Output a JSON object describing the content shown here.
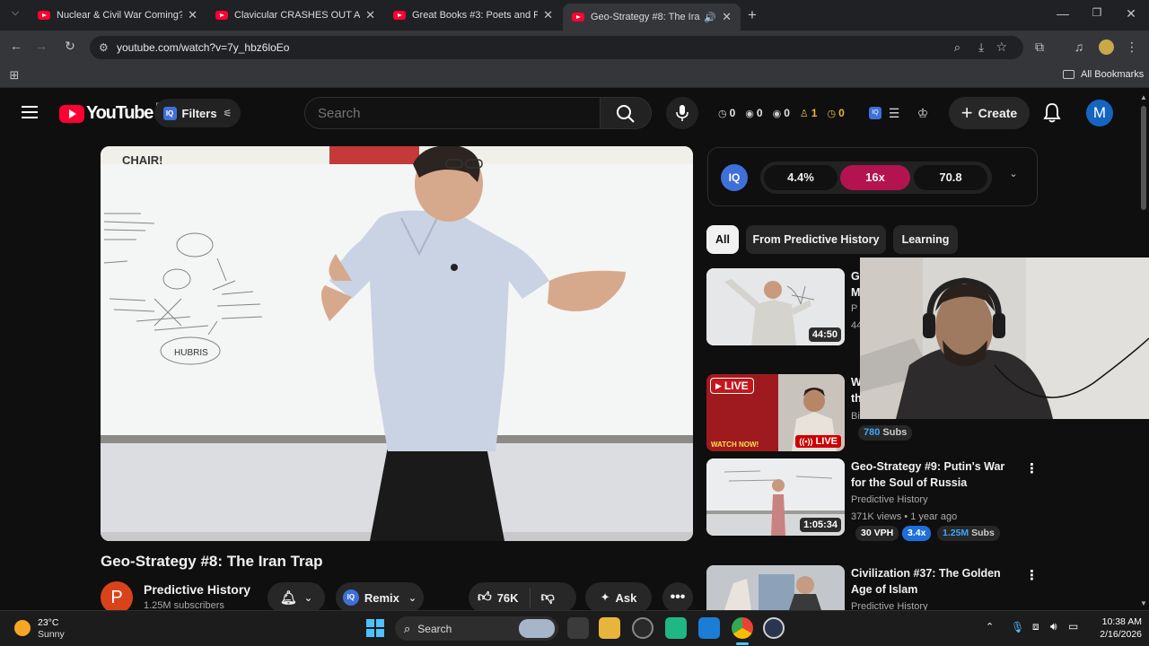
{
  "browser": {
    "tabs": [
      {
        "title": "Nuclear & Civil War Coming? C"
      },
      {
        "title": "Clavicular CRASHES OUT After"
      },
      {
        "title": "Great Books #3: Poets and Prop"
      },
      {
        "title": "Geo-Strategy #8: The Iran Tr"
      }
    ],
    "new_tab": "+",
    "url": "youtube.com/watch?v=7y_hbz6loEo",
    "all_bookmarks": "All Bookmarks"
  },
  "yt_header": {
    "logo_text": "YouTube",
    "logo_country": "PK",
    "filters_label": "Filters",
    "search_placeholder": "Search",
    "stats": [
      "0",
      "0",
      "0",
      "1",
      "0"
    ],
    "create_label": "Create",
    "avatar_letter": "M"
  },
  "ext_bar": {
    "values": [
      "4.4%",
      "16x",
      "70.8"
    ]
  },
  "video": {
    "title": "Geo-Strategy #8: The Iran Trap",
    "board_text": "CHAIR!",
    "board_circle": "HUBRIS",
    "channel_avatar": "P",
    "channel_name": "Predictive History",
    "subscribers": "1.25M subscribers",
    "remix_label": "Remix",
    "likes": "76K",
    "ask_label": "Ask"
  },
  "chips": [
    "All",
    "From Predictive History",
    "Learning"
  ],
  "related": [
    {
      "title_frag": "G",
      "title_frag2": "M",
      "channel_frag": "P",
      "meta_frag": "44",
      "duration": "44:50"
    },
    {
      "title_frag": "W",
      "title_frag2": "th",
      "channel_frag": "Bi",
      "live_badge": "LIVE",
      "live_label": "LIVE",
      "watch_now": "WATCH NOW!",
      "subs_num": "780",
      "subs_label": "Subs"
    },
    {
      "title": "Geo-Strategy #9:  Putin's War for the Soul of Russia",
      "channel": "Predictive History",
      "meta": "371K views • 1 year ago",
      "vph": "30 VPH",
      "multiplier": "3.4x",
      "subs_num": "1.25M",
      "subs_label": "Subs",
      "duration": "1:05:34"
    },
    {
      "title": "Civilization #37:  The Golden Age of Islam",
      "channel": "Predictive History"
    }
  ],
  "taskbar": {
    "temp": "23°C",
    "weather": "Sunny",
    "search": "Search",
    "time": "10:38 AM",
    "date": "2/16/2026"
  }
}
